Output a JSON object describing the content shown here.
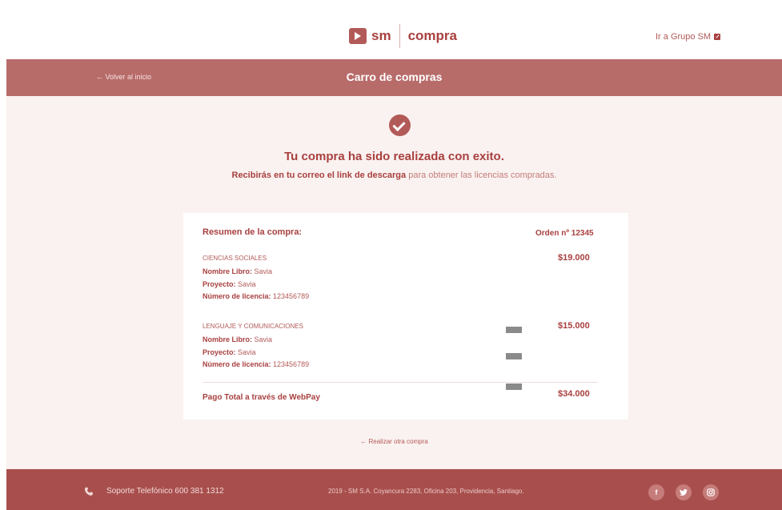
{
  "header": {
    "logo_sm": "sm",
    "logo_compra": "compra",
    "grupo_link": "Ir a Grupo SM"
  },
  "titlebar": {
    "back_link": "← Volver al inicio",
    "title": "Carro de compras"
  },
  "success": {
    "title": "Tu compra ha sido realizada con exito.",
    "sub_bold": "Recibirás en tu correo el link de descarga",
    "sub_rest": " para obtener las licencias compradas."
  },
  "summary": {
    "heading": "Resumen de la compra:",
    "order": "Orden nº 12345",
    "items": [
      {
        "category": "CIENCIAS SOCIALES",
        "price": "$19.000",
        "book_label": "Nombre Libro:",
        "book_value": " Savia",
        "project_label": "Proyecto:",
        "project_value": " Savia",
        "license_label": "Número de licencia:",
        "license_value": " 123456789"
      },
      {
        "category": "LENGUAJE Y COMUNICACIONES",
        "price": "$15.000",
        "book_label": "Nombre Libro:",
        "book_value": " Savia",
        "project_label": "Proyecto:",
        "project_value": " Savia",
        "license_label": "Número de licencia:",
        "license_value": " 123456789"
      }
    ],
    "total_label": "Pago Total a través de WebPay",
    "total_amount": "$34.000"
  },
  "otra_compra": "← Realizar otra compra",
  "footer": {
    "soporte": "Soporte Telefónico 600 381 1312",
    "address": "2019 - SM S.A. Coyancura 2283, Oficina 203, Providencia, Santiago.",
    "social": [
      "f",
      "t",
      "ig"
    ]
  },
  "colors": {
    "brand": "#b25a58",
    "titlebar": "#b86c6a",
    "footer": "#a84f4d",
    "background": "#faf2f0"
  }
}
